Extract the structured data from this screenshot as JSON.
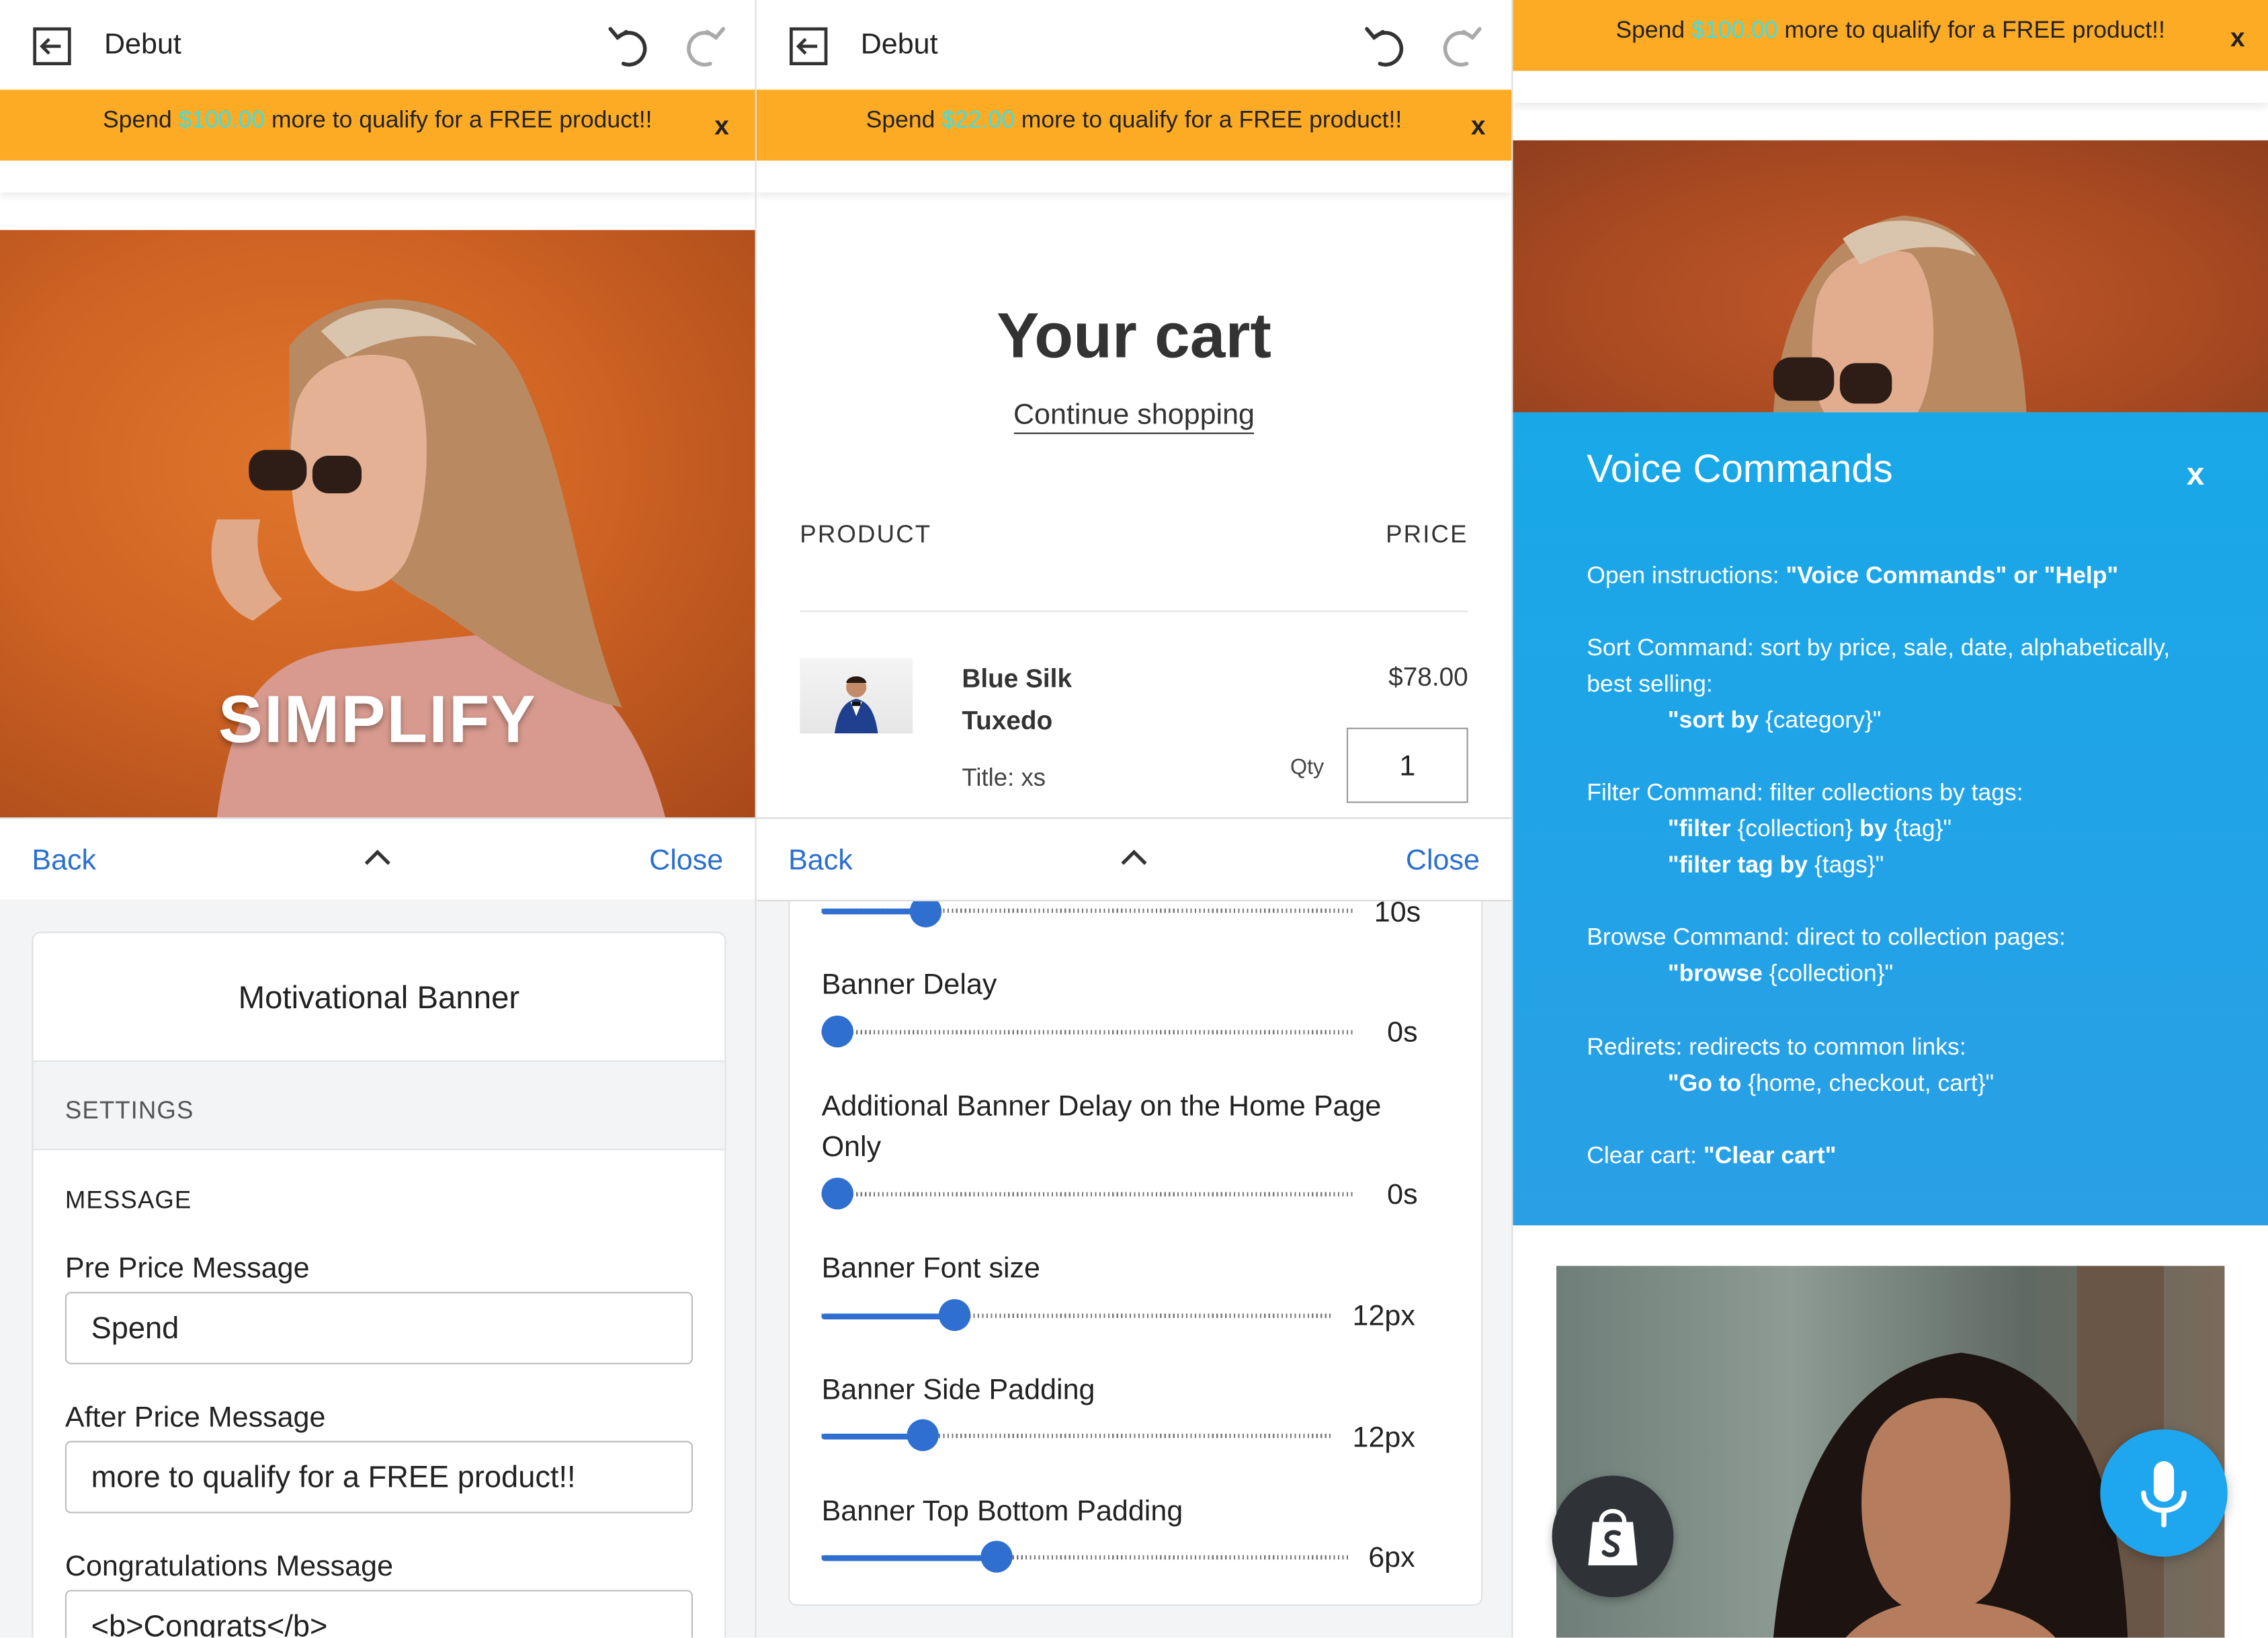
{
  "editor": {
    "theme_name": "Debut",
    "back_label": "Back",
    "close_label": "Close"
  },
  "banner": {
    "pre": "Spend",
    "post": "more to qualify for a FREE product!!",
    "close": "x",
    "amount_panel1": "$100.00",
    "amount_panel2": "$22.00",
    "amount_panel3": "$100.00",
    "colors": {
      "background": "#fdab25",
      "amount": "#3bdfe8"
    }
  },
  "hero": {
    "title": "SIMPLIFY"
  },
  "settings": {
    "card_title": "Motivational Banner",
    "section": "SETTINGS",
    "group": "MESSAGE",
    "fields": [
      {
        "label": "Pre Price Message",
        "value": "Spend"
      },
      {
        "label": "After Price Message",
        "value": "more to qualify for a FREE product!!"
      },
      {
        "label": "Congratulations Message",
        "value": "<b>Congrats</b>"
      }
    ]
  },
  "cart": {
    "title": "Your cart",
    "continue_shopping": "Continue shopping",
    "col_product": "PRODUCT",
    "col_price": "PRICE",
    "item": {
      "name_line1": "Blue Silk",
      "name_line2": "Tuxedo",
      "variant": "Title: xs",
      "price": "$78.00",
      "qty_label": "Qty",
      "qty": "1"
    }
  },
  "sliders": [
    {
      "label": "",
      "value": "10s",
      "fraction": 0.18
    },
    {
      "label": "Banner Delay",
      "value": "0s",
      "fraction": 0.0
    },
    {
      "label": "Additional Banner Delay on the Home Page Only",
      "value": "0s",
      "fraction": 0.0
    },
    {
      "label": "Banner Font size",
      "value": "12px",
      "fraction": 0.25
    },
    {
      "label": "Banner Side Padding",
      "value": "12px",
      "fraction": 0.19
    },
    {
      "label": "Banner Top Bottom Padding",
      "value": "6px",
      "fraction": 0.31
    }
  ],
  "voice": {
    "title": "Voice Commands",
    "close": "x",
    "lines": {
      "open_a": "Open instructions: ",
      "open_b": "\"Voice Commands\" or \"Help\"",
      "sort_a": "Sort Command: sort by price, sale, date, alphabetically,",
      "sort_b": "best selling:",
      "sort_c1": "\"sort by",
      "sort_c2": " {category}\"",
      "filter_a": "Filter Command: filter collections by tags:",
      "filter_b1": "\"filter",
      "filter_b2": " {collection} ",
      "filter_b3": "by",
      "filter_b4": " {tag}\"",
      "filter_c1": "\"filter tag by",
      "filter_c2": " {tags}\"",
      "browse_a": "Browse Command: direct to collection pages:",
      "browse_b1": "\"browse",
      "browse_b2": " {collection}\"",
      "redirect_a": "Redirets: redirects to common links:",
      "redirect_b1": "\"Go to",
      "redirect_b2": " {home, checkout, cart}\"",
      "clear_a": "Clear cart: ",
      "clear_b": "\"Clear cart\""
    },
    "color": "#18a8e8"
  },
  "icons": [
    "exit-icon",
    "undo-icon",
    "redo-icon",
    "chevron-up-icon",
    "shopify-bag-icon",
    "microphone-icon"
  ]
}
